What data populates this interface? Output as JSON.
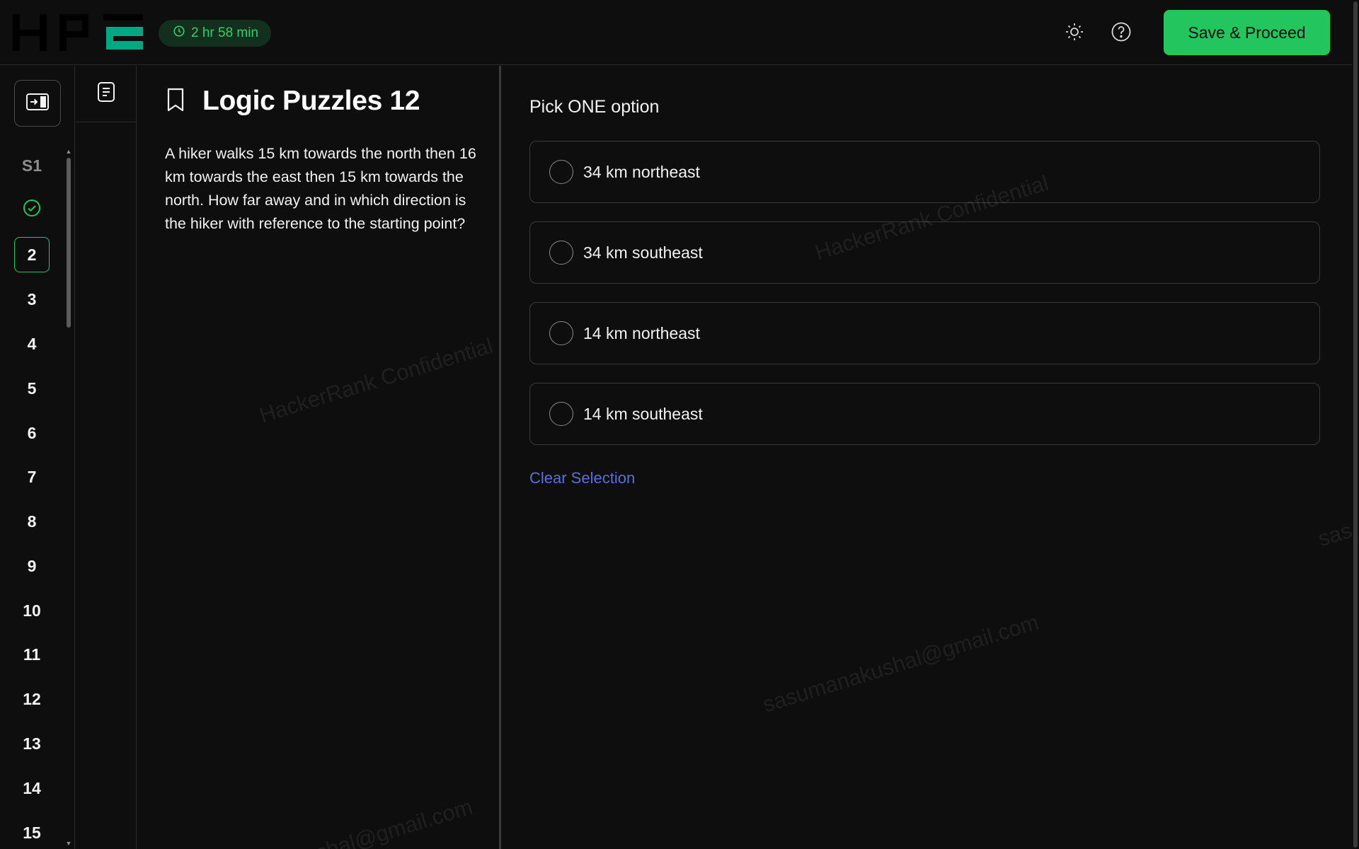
{
  "header": {
    "logo_text": "HPE",
    "timer": "2 hr 58 min",
    "save_label": "Save & Proceed",
    "accent_color": "#22c55e"
  },
  "nav": {
    "section_label": "S1",
    "items": [
      "2",
      "3",
      "4",
      "5",
      "6",
      "7",
      "8",
      "9",
      "10",
      "11",
      "12",
      "13",
      "14",
      "15"
    ],
    "current": "2",
    "completed_icon": "check-circle-icon"
  },
  "question": {
    "title": "Logic Puzzles 12",
    "text": "A hiker walks 15 km towards the north then 16 km towards the east then 15 km towards the north.  How far away and in which direction is the hiker with reference to the starting point?"
  },
  "answer": {
    "prompt": "Pick ONE option",
    "options": [
      "34 km northeast",
      "34 km southeast",
      "14 km northeast",
      "14 km southeast"
    ],
    "clear_label": "Clear Selection"
  },
  "watermarks": {
    "confidential": "HackerRank Confidential",
    "email": "sasumanakushal@gmail.com",
    "email_partial": "kushal@gmail.com",
    "edge_partial": "sas"
  }
}
